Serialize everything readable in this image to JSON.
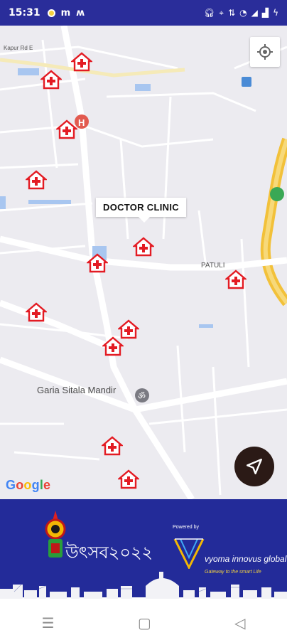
{
  "status_bar": {
    "time": "15:31",
    "left_icons": [
      "notification-dot-icon",
      "m-icon",
      "m-alt-icon"
    ],
    "right_icons": [
      "headset-icon",
      "location-icon",
      "data-icon",
      "wifi-icon",
      "signal-icon",
      "signal-bars-icon",
      "battery-charging-icon"
    ]
  },
  "map": {
    "labels": {
      "road_top": "Kapur Rd E",
      "area": "PATULI",
      "place": "Garia Sitala Mandir"
    },
    "tooltip": "DOCTOR CLINIC",
    "attribution": "Google",
    "google_letters": [
      "G",
      "o",
      "o",
      "g",
      "l",
      "e"
    ],
    "marker_color": "#e31b23"
  },
  "banner": {
    "festival_text": "উৎসব২০২২",
    "powered_by": "Powered by",
    "brand": "vyoma innovus global",
    "tagline": "Gateway to the smart Life"
  },
  "nav_bar": {
    "menu": "☰",
    "home": "▢",
    "back": "◁"
  }
}
